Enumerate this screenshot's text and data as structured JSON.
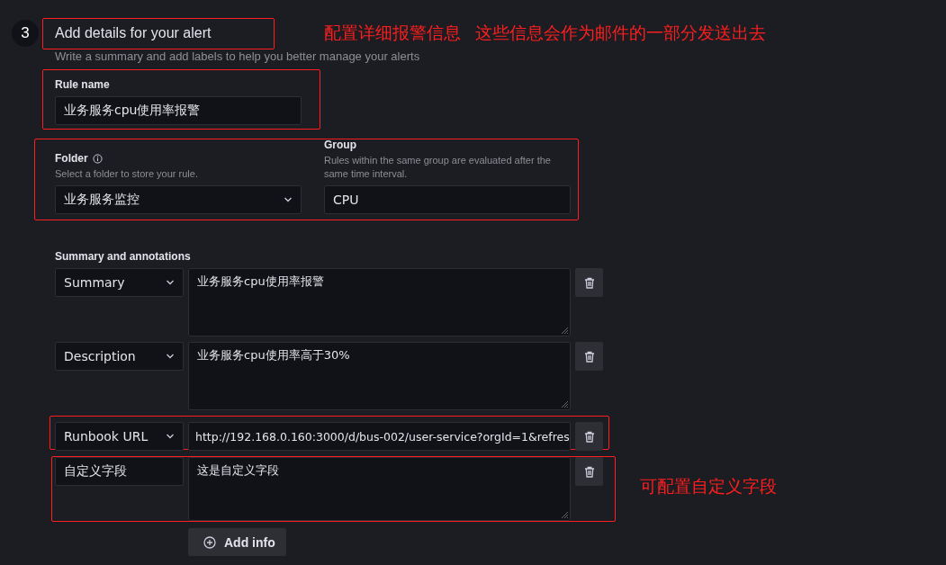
{
  "step": {
    "number": "3",
    "title": "Add details for your alert",
    "subtitle": "Write a summary and add labels to help you better manage your alerts"
  },
  "callouts": [
    "配置详细报警信息",
    "这些信息会作为邮件的一部分发送出去",
    "可配置自定义字段"
  ],
  "rule_name": {
    "label": "Rule name",
    "value": "业务服务cpu使用率报警"
  },
  "folder": {
    "label": "Folder",
    "description": "Select a folder to store your rule.",
    "value": "业务服务监控"
  },
  "group": {
    "label": "Group",
    "description": "Rules within the same group are evaluated after the same time interval.",
    "value": "CPU"
  },
  "annotations": {
    "label": "Summary and annotations",
    "rows": [
      {
        "kind": "dropdown",
        "key": "Summary",
        "value": "业务服务cpu使用率报警",
        "multiline": true,
        "highlighted": false
      },
      {
        "kind": "dropdown",
        "key": "Description",
        "value": "业务服务cpu使用率高于30%",
        "multiline": true,
        "highlighted": false
      },
      {
        "kind": "dropdown",
        "key": "Runbook URL",
        "value": "http://192.168.0.160:3000/d/bus-002/user-service?orgId=1&refres",
        "multiline": false,
        "highlighted": true
      },
      {
        "kind": "text",
        "key": "自定义字段",
        "value": "这是自定义字段",
        "multiline": true,
        "highlighted": true
      }
    ]
  },
  "add_button": "Add info"
}
